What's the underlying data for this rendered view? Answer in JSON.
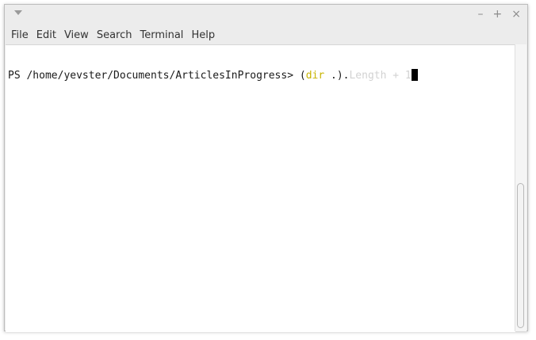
{
  "window": {
    "controls": {
      "minimize": "–",
      "maximize": "+",
      "close": "×"
    }
  },
  "menubar": {
    "items": [
      "File",
      "Edit",
      "View",
      "Search",
      "Terminal",
      "Help"
    ]
  },
  "terminal": {
    "prompt": "PS /home/yevster/Documents/ArticlesInProgress> ",
    "input": {
      "open_paren": "(",
      "command": "dir",
      "arg": " .",
      "close_dot": ").",
      "suggestion": "Length + 1"
    },
    "colors": {
      "command": "#c8b400",
      "suggestion": "#d2d2d2"
    }
  }
}
